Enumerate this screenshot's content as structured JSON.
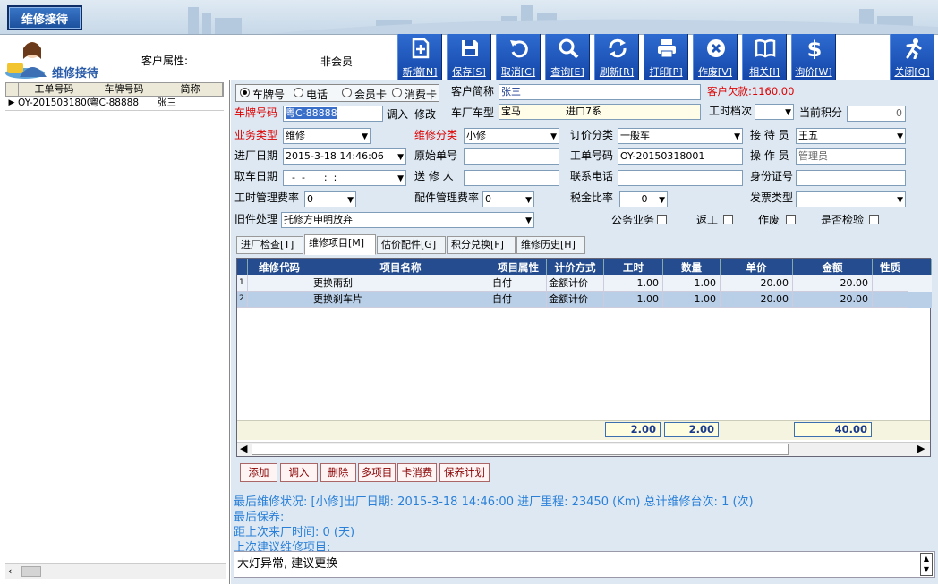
{
  "window": {
    "title": "维修接待"
  },
  "header": {
    "subtitle": "维修接待",
    "customer_attr_label": "客户属性:",
    "customer_attr_value": "非会员"
  },
  "toolbar": {
    "buttons": [
      {
        "label": "新增[N]",
        "icon": "add-doc-icon"
      },
      {
        "label": "保存[S]",
        "icon": "save-icon"
      },
      {
        "label": "取消[C]",
        "icon": "undo-icon"
      },
      {
        "label": "查询[E]",
        "icon": "search-icon"
      },
      {
        "label": "刷新[R]",
        "icon": "refresh-icon"
      },
      {
        "label": "打印[P]",
        "icon": "printer-icon"
      },
      {
        "label": "作废[V]",
        "icon": "cancel-icon"
      },
      {
        "label": "相关[I]",
        "icon": "book-icon"
      },
      {
        "label": "询价[W]",
        "icon": "dollar-icon"
      },
      {
        "label": "关闭[Q]",
        "icon": "run-icon"
      }
    ]
  },
  "left_grid": {
    "columns": [
      "工单号码",
      "车牌号码",
      "简称"
    ],
    "rows": [
      {
        "order_no": "OY-2015031800",
        "plate": "粤C-88888",
        "name": "张三"
      }
    ]
  },
  "search": {
    "radios": [
      "车牌号",
      "电话",
      "会员卡",
      "消费卡"
    ],
    "selected": "车牌号"
  },
  "form": {
    "customer_name_label": "客户简称",
    "customer_name": "张三",
    "debt_label": "客户欠款:",
    "debt_value": "1160.00",
    "plate_label": "车牌号码",
    "plate_value": "粤C-88888",
    "import_btn": "调入",
    "modify_btn": "修改",
    "car_model_label": "车厂车型",
    "car_brand": "宝马",
    "car_model": "进口7系",
    "labor_level_label": "工时档次",
    "points_label": "当前积分",
    "points_value": "0",
    "biz_type_label": "业务类型",
    "biz_type": "维修",
    "repair_cat_label": "维修分类",
    "repair_cat": "小修",
    "price_cat_label": "订价分类",
    "price_cat": "一般车",
    "receptionist_label": "接 待 员",
    "receptionist": "王五",
    "in_date_label": "进厂日期",
    "in_date": "2015-3-18  14:46:06",
    "orig_no_label": "原始单号",
    "order_no_label": "工单号码",
    "order_no": "OY-20150318001",
    "operator_label": "操 作 员",
    "operator": "管理员",
    "pickup_date_label": "取车日期",
    "pickup_date": "  -  -      :  :",
    "sender_label": "送 修 人",
    "phone_label": "联系电话",
    "id_label": "身份证号",
    "labor_fee_label": "工时管理费率",
    "labor_fee": "0",
    "parts_fee_label": "配件管理费率",
    "parts_fee": "0",
    "tax_label": "税金比率",
    "tax": "0",
    "invoice_label": "发票类型",
    "old_parts_label": "旧件处理",
    "old_parts": "托修方申明放弃",
    "public_label": "公务业务",
    "rework_label": "返工",
    "void_label": "作废",
    "inspect_label": "是否检验"
  },
  "tabs": [
    "进厂检查[T]",
    "维修项目[M]",
    "估价配件[G]",
    "积分兑换[F]",
    "维修历史[H]"
  ],
  "active_tab": "维修项目[M]",
  "items": {
    "columns": [
      "维修代码",
      "项目名称",
      "项目属性",
      "计价方式",
      "工时",
      "数量",
      "单价",
      "金额",
      "性质"
    ],
    "rows": [
      {
        "no": "1",
        "code": "",
        "name": "更换雨刮",
        "attr": "自付",
        "pricing": "金额计价",
        "hours": "1.00",
        "qty": "1.00",
        "price": "20.00",
        "amount": "20.00",
        "nature": ""
      },
      {
        "no": "2",
        "code": "",
        "name": "更换刹车片",
        "attr": "自付",
        "pricing": "金额计价",
        "hours": "1.00",
        "qty": "1.00",
        "price": "20.00",
        "amount": "20.00",
        "nature": ""
      }
    ],
    "totals": {
      "hours": "2.00",
      "qty": "2.00",
      "amount": "40.00"
    }
  },
  "actions": [
    "添加",
    "调入",
    "删除",
    "多项目",
    "卡消费",
    "保养计划"
  ],
  "info": {
    "last_repair": "最后维修状况: [小修]出厂日期: 2015-3-18 14:46:00 进厂里程: 23450 (Km)  总计维修台次: 1 (次)",
    "last_maintenance": "最后保养:",
    "since_last": "距上次来厂时间: 0 (天)",
    "suggest_label": "上次建议维修项目:",
    "suggest_text": "大灯异常, 建议更换"
  }
}
